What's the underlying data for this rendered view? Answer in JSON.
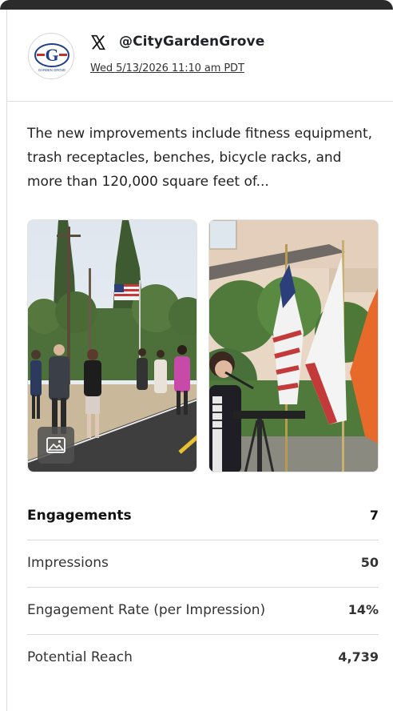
{
  "post": {
    "handle": "@CityGardenGrove",
    "timestamp": "Wed 5/13/2026 11:10 am PDT",
    "avatar_letter": "G",
    "avatar_caption": "GARDEN GROVE",
    "text": "The new improvements include fitness equipment, trash receptacles, benches, bicycle racks, and more than 120,000 square feet of..."
  },
  "icons": {
    "network": "x-logo-icon",
    "media_badge": "image-icon"
  },
  "stats": [
    {
      "label": "Engagements",
      "value": "7"
    },
    {
      "label": "Impressions",
      "value": "50"
    },
    {
      "label": "Engagement Rate (per Impression)",
      "value": "14%"
    },
    {
      "label": "Potential Reach",
      "value": "4,739"
    }
  ],
  "colors": {
    "brand_blue": "#1f3f8f",
    "text": "#222222",
    "divider": "#d9d9d9"
  }
}
